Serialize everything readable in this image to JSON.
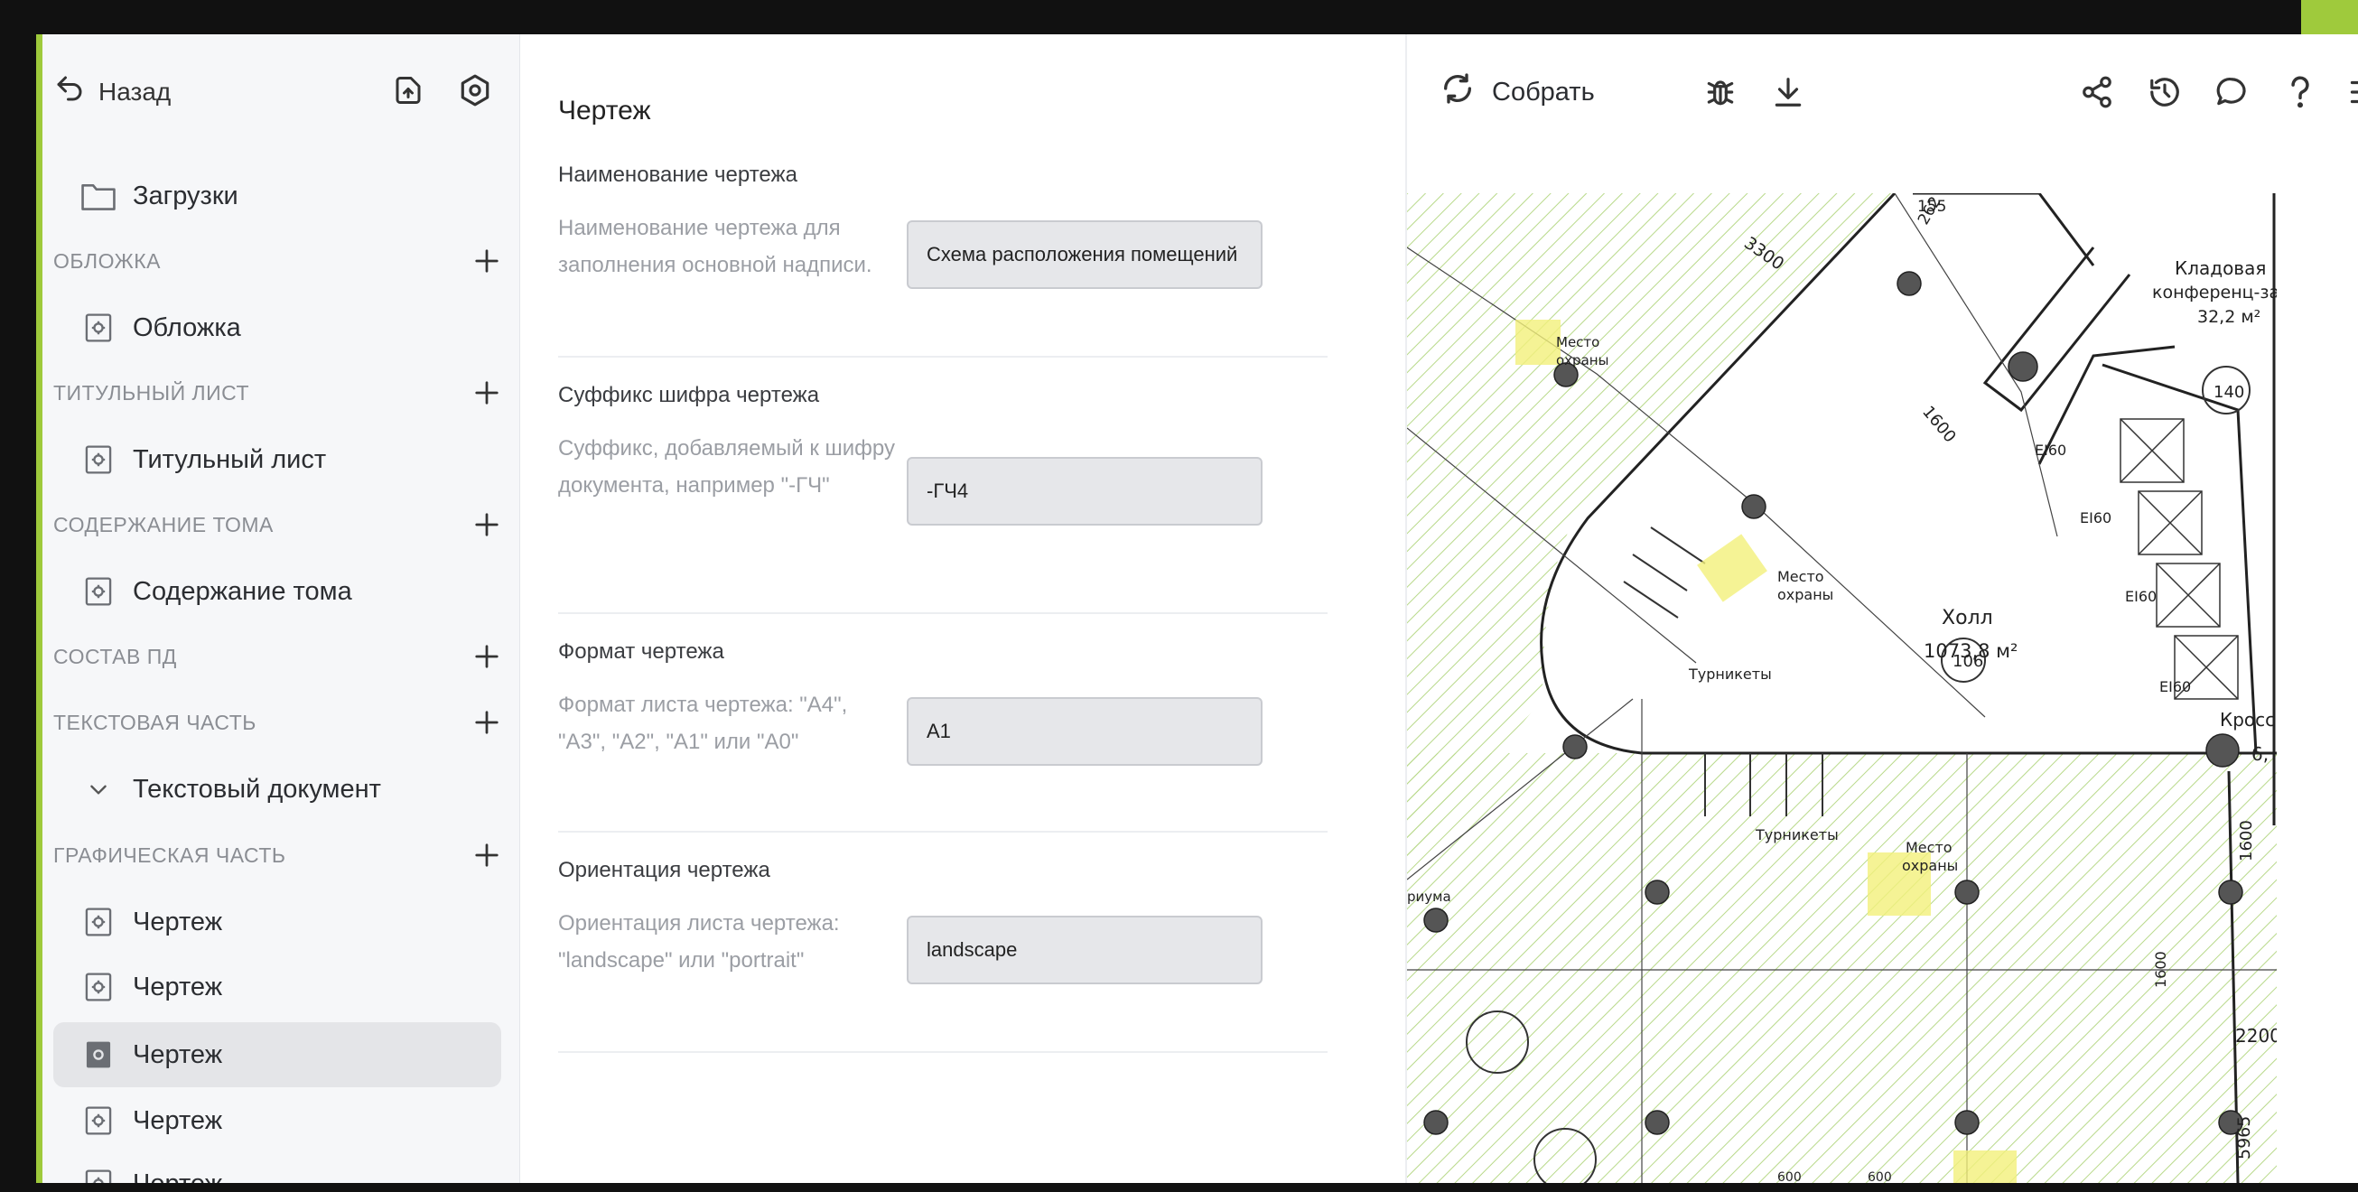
{
  "sidebar": {
    "back_label": "Назад",
    "uploads_label": "Загрузки",
    "sections": [
      {
        "title": "ОБЛОЖКА",
        "items": [
          "Обложка"
        ]
      },
      {
        "title": "ТИТУЛЬНЫЙ ЛИСТ",
        "items": [
          "Титульный лист"
        ]
      },
      {
        "title": "СОДЕРЖАНИЕ ТОМА",
        "items": [
          "Содержание тома"
        ]
      },
      {
        "title": "СОСТАВ ПД",
        "items": []
      },
      {
        "title": "ТЕКСТОВАЯ ЧАСТЬ",
        "items": [
          "Текстовый документ"
        ]
      },
      {
        "title": "ГРАФИЧЕСКАЯ ЧАСТЬ",
        "items": [
          "Чертеж",
          "Чертеж",
          "Чертеж",
          "Чертеж",
          "Чертеж"
        ]
      }
    ],
    "selected_item": "Чертеж"
  },
  "form": {
    "title": "Чертеж",
    "fields": [
      {
        "label": "Наименование чертежа",
        "help": "Наименование чертежа для заполнения основной надписи.",
        "value": "Схема расположения помещений"
      },
      {
        "label": "Суффикс шифра чертежа",
        "help": "Суффикс, добавляемый к шифру документа, например \"-ГЧ\"",
        "value": "-ГЧ4"
      },
      {
        "label": "Формат чертежа",
        "help": "Формат листа чертежа: \"A4\", \"A3\", \"A2\", \"A1\" или \"A0\"",
        "value": "A1"
      },
      {
        "label": "Ориентация чертежа",
        "help": "Ориентация листа чертежа: \"landscape\" или \"portrait\"",
        "value": "landscape"
      }
    ]
  },
  "toolbar": {
    "build_label": "Собрать",
    "icons": [
      "bug-icon",
      "download-icon",
      "share-icon",
      "history-icon",
      "comment-icon",
      "help-icon",
      "menu-icon"
    ]
  },
  "drawing": {
    "labels": {
      "storage_name": "Кладовая",
      "storage_name2": "конференц-за",
      "storage_area": "32,2 м²",
      "storage_num": "140",
      "hall_name": "Холл",
      "hall_area": "1073,8 м²",
      "hall_num": "106",
      "guard1": "Место",
      "guard2": "охраны",
      "turnstiles": "Турникеты",
      "dim_3300": "3300",
      "dim_1600": "1600",
      "dim_2200": "2200",
      "dim_5965": "5965",
      "dim_600": "600",
      "ei60": "EI60",
      "kross": "Кросс",
      "rium": "риума",
      "dim_155": "155",
      "dim_262": "262",
      "dim_6": "6,"
    }
  },
  "colors": {
    "accent_bg": "#9fca3c",
    "selected_bg": "#e4e5e8",
    "hatch": "#b8d98a",
    "guard_fill": "#f2f07a"
  }
}
